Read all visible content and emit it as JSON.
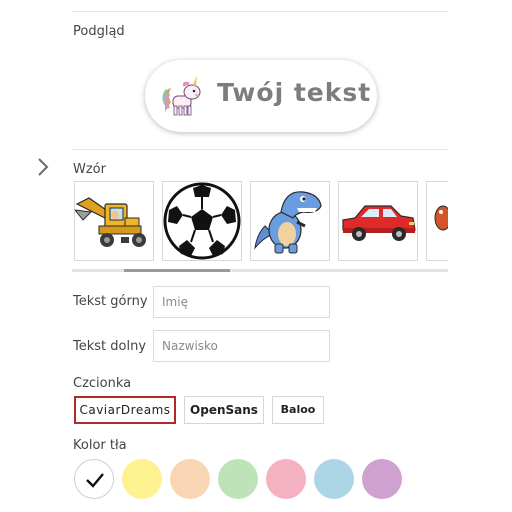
{
  "preview": {
    "label": "Podgląd",
    "sample_text": "Twój tekst",
    "icon": "unicorn-icon"
  },
  "pattern": {
    "label": "Wzór",
    "tiles": [
      {
        "name": "excavator",
        "icon": "excavator-icon"
      },
      {
        "name": "soccer-ball",
        "icon": "soccer-ball-icon"
      },
      {
        "name": "dinosaur",
        "icon": "dinosaur-icon"
      },
      {
        "name": "car",
        "icon": "red-car-icon"
      },
      {
        "name": "partial",
        "icon": "orange-pattern-icon"
      }
    ]
  },
  "text_top": {
    "label": "Tekst górny",
    "placeholder": "Imię",
    "value": ""
  },
  "text_bottom": {
    "label": "Tekst dolny",
    "placeholder": "Nazwisko",
    "value": ""
  },
  "font": {
    "label": "Czcionka",
    "options": [
      "CaviarDreams",
      "OpenSans",
      "Baloo"
    ],
    "selected": "CaviarDreams"
  },
  "bg_color": {
    "label": "Kolor tła",
    "selected": "#ffffff",
    "swatches": [
      "#ffffff",
      "#fdf28f",
      "#f9d6b3",
      "#bfe3b9",
      "#f4b1c1",
      "#acd6e6",
      "#cfa1d1"
    ]
  }
}
